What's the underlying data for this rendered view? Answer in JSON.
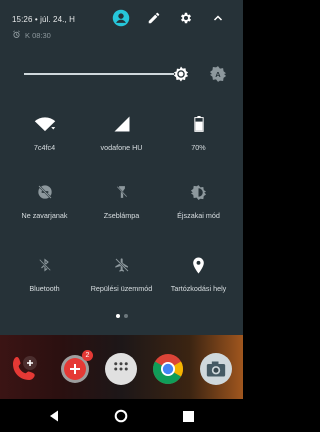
{
  "status": {
    "time": "15:26",
    "date": "júl. 24., H",
    "alarm": "K 08:30"
  },
  "header_icons": [
    "account-icon",
    "edit-icon",
    "settings-icon",
    "collapse-icon"
  ],
  "brightness": {
    "level": 0.84,
    "auto_label": "A"
  },
  "tiles": [
    {
      "label": "7c4fc4",
      "icon": "wifi-icon"
    },
    {
      "label": "vodafone HU",
      "icon": "cellular-signal-icon"
    },
    {
      "label": "70%",
      "icon": "battery-icon"
    },
    {
      "label": "Ne zavarjanak",
      "icon": "do-not-disturb-icon"
    },
    {
      "label": "Zseblámpa",
      "icon": "flashlight-icon"
    },
    {
      "label": "Éjszakai mód",
      "icon": "night-mode-icon"
    },
    {
      "label": "Bluetooth",
      "icon": "bluetooth-icon"
    },
    {
      "label": "Repülési üzemmód",
      "icon": "airplane-mode-icon"
    },
    {
      "label": "Tartózkodási hely",
      "icon": "location-icon"
    }
  ],
  "page_indicator": {
    "pages": 2,
    "current": 1
  },
  "home_apps": [
    {
      "name": "phone-app-icon"
    },
    {
      "name": "messages-app-icon",
      "badge": "2"
    },
    {
      "name": "app-drawer-icon"
    },
    {
      "name": "chrome-app-icon"
    },
    {
      "name": "camera-app-icon"
    }
  ],
  "colors": {
    "panel": "#263238",
    "accent": "#26c6da",
    "icon": "#ffffff",
    "inactive": "#8d989d"
  }
}
